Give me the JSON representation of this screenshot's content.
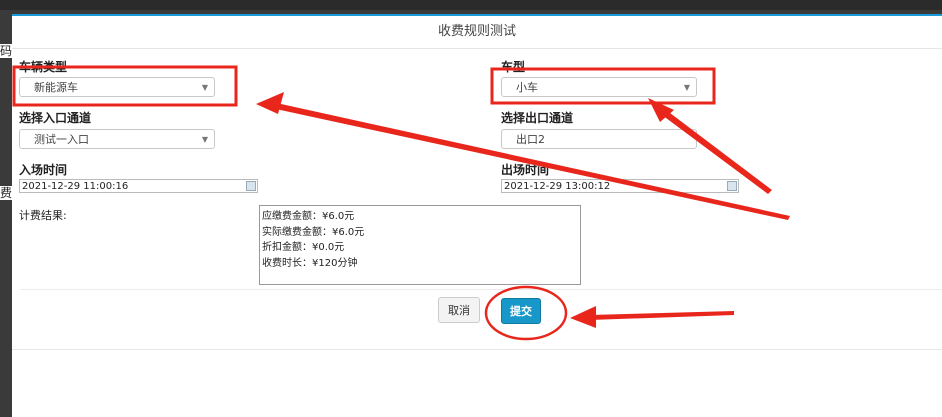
{
  "background": {
    "fragments": [
      "码",
      "费"
    ]
  },
  "modal": {
    "title": "收费规则测试",
    "accent_color": "#1a9bd7"
  },
  "form": {
    "vehicle_type": {
      "label": "车辆类型",
      "value": "新能源车"
    },
    "car_model": {
      "label": "车型",
      "value": "小车"
    },
    "entry_channel": {
      "label": "选择入口通道",
      "value": "测试一入口"
    },
    "exit_channel": {
      "label": "选择出口通道",
      "value": "出口2"
    },
    "entry_time": {
      "label": "入场时间",
      "value": "2021-12-29 11:00:16"
    },
    "exit_time": {
      "label": "出场时间",
      "value": "2021-12-29 13:00:12"
    },
    "result": {
      "label": "计费结果:",
      "lines": [
        "应缴费金额：¥6.0元",
        "实际缴费金额：¥6.0元",
        "折扣金额：¥0.0元",
        "收费时长：¥120分钟"
      ]
    }
  },
  "buttons": {
    "cancel": "取消",
    "submit": "提交",
    "submit_color": "#1798c9"
  },
  "annotation_color": "#e8261c"
}
